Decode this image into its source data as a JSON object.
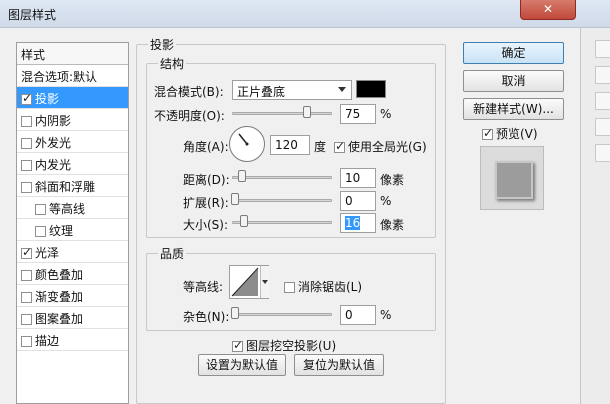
{
  "window": {
    "title": "图层样式",
    "close_glyph": "✕"
  },
  "left_panel": {
    "header": "样式",
    "items": [
      {
        "label": "混合选项:默认",
        "checkbox": false,
        "checked": false,
        "selected": false,
        "indent": false
      },
      {
        "label": "投影",
        "checkbox": true,
        "checked": true,
        "selected": true,
        "indent": false
      },
      {
        "label": "内阴影",
        "checkbox": true,
        "checked": false,
        "selected": false,
        "indent": false
      },
      {
        "label": "外发光",
        "checkbox": true,
        "checked": false,
        "selected": false,
        "indent": false
      },
      {
        "label": "内发光",
        "checkbox": true,
        "checked": false,
        "selected": false,
        "indent": false
      },
      {
        "label": "斜面和浮雕",
        "checkbox": true,
        "checked": false,
        "selected": false,
        "indent": false
      },
      {
        "label": "等高线",
        "checkbox": true,
        "checked": false,
        "selected": false,
        "indent": true
      },
      {
        "label": "纹理",
        "checkbox": true,
        "checked": false,
        "selected": false,
        "indent": true
      },
      {
        "label": "光泽",
        "checkbox": true,
        "checked": true,
        "selected": false,
        "indent": false
      },
      {
        "label": "颜色叠加",
        "checkbox": true,
        "checked": false,
        "selected": false,
        "indent": false
      },
      {
        "label": "渐变叠加",
        "checkbox": true,
        "checked": false,
        "selected": false,
        "indent": false
      },
      {
        "label": "图案叠加",
        "checkbox": true,
        "checked": false,
        "selected": false,
        "indent": false
      },
      {
        "label": "描边",
        "checkbox": true,
        "checked": false,
        "selected": false,
        "indent": false
      }
    ]
  },
  "section": {
    "title": "投影",
    "structure": {
      "title": "结构",
      "blend_mode_label": "混合模式(B):",
      "blend_mode_value": "正片叠底",
      "blend_color": "#000000",
      "opacity_label": "不透明度(O):",
      "opacity_value": "75",
      "opacity_unit": "%",
      "angle_label": "角度(A):",
      "angle_value": "120",
      "angle_unit": "度",
      "global_light_label": "使用全局光(G)",
      "global_light_checked": true,
      "distance_label": "距离(D):",
      "distance_value": "10",
      "distance_unit": "像素",
      "spread_label": "扩展(R):",
      "spread_value": "0",
      "spread_unit": "%",
      "size_label": "大小(S):",
      "size_value": "16",
      "size_unit": "像素"
    },
    "quality": {
      "title": "品质",
      "contour_label": "等高线:",
      "antialias_label": "消除锯齿(L)",
      "antialias_checked": false,
      "noise_label": "杂色(N):",
      "noise_value": "0",
      "noise_unit": "%"
    },
    "knockout_label": "图层挖空投影(U)",
    "knockout_checked": true,
    "set_default_label": "设置为默认值",
    "reset_default_label": "复位为默认值"
  },
  "buttons": {
    "ok": "确定",
    "cancel": "取消",
    "new_style": "新建样式(W)..."
  },
  "preview": {
    "label": "预览(V)",
    "checked": true
  }
}
